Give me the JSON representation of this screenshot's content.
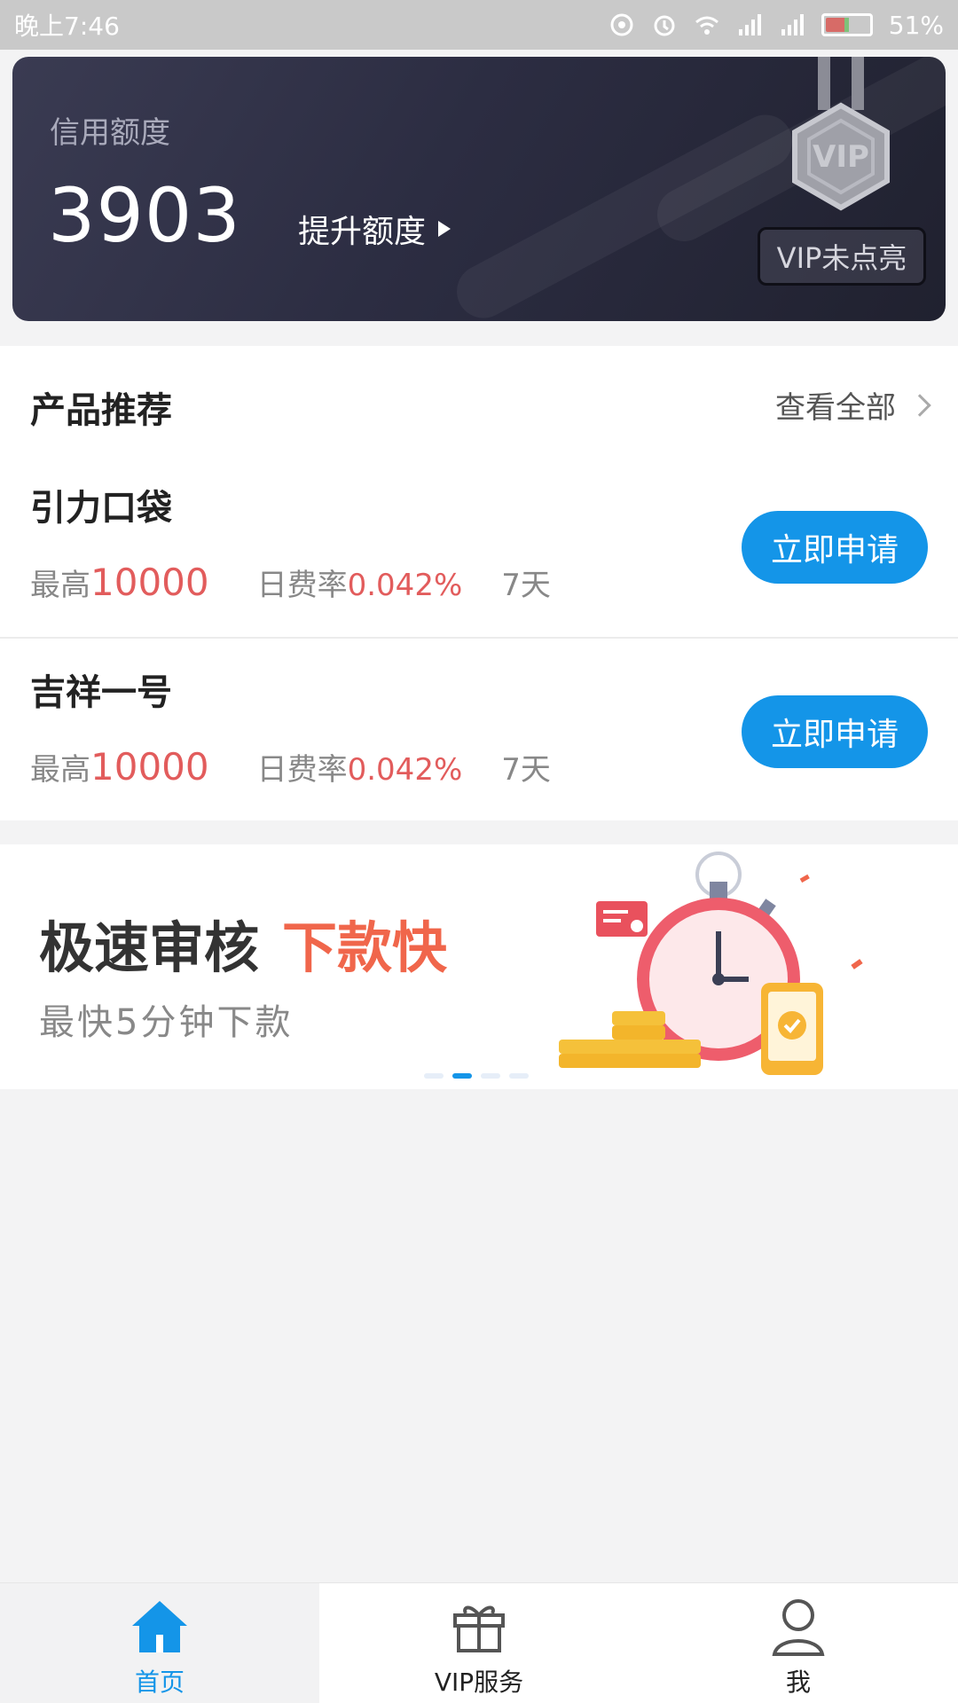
{
  "status_bar": {
    "time": "晚上7:46",
    "battery": "51%"
  },
  "credit_card": {
    "title": "信用额度",
    "amount": "3903",
    "raise_label": "提升额度",
    "vip_label": "VIP未点亮",
    "vip_medal_text": "VIP"
  },
  "products": {
    "header": "产品推荐",
    "view_all": "查看全部",
    "items": [
      {
        "name": "引力口袋",
        "max_label": "最高",
        "max_value": "10000",
        "rate_label": "日费率",
        "rate_value": "0.042%",
        "term": "7天",
        "apply_label": "立即申请"
      },
      {
        "name": "吉祥一号",
        "max_label": "最高",
        "max_value": "10000",
        "rate_label": "日费率",
        "rate_value": "0.042%",
        "term": "7天",
        "apply_label": "立即申请"
      }
    ]
  },
  "banner": {
    "title_main": "极速审核",
    "title_accent": "下款快",
    "subtitle": "最快5分钟下款",
    "active_slide": 2,
    "slide_count": 4
  },
  "tabbar": {
    "tabs": [
      {
        "label": "首页",
        "icon": "home-icon",
        "active": true
      },
      {
        "label": "VIP服务",
        "icon": "gift-icon",
        "active": false
      },
      {
        "label": "我",
        "icon": "user-icon",
        "active": false
      }
    ]
  },
  "colors": {
    "accent_blue": "#1495e8",
    "value_red": "#e25c5c",
    "banner_orange": "#f0664b"
  }
}
